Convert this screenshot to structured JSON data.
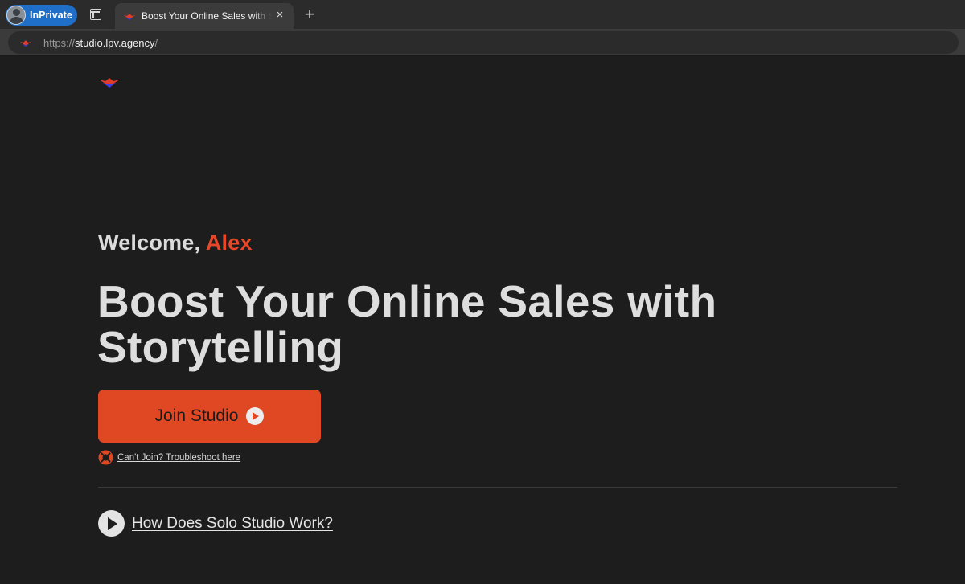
{
  "browser": {
    "inprivate_label": "InPrivate",
    "tab_title": "Boost Your Online Sales with Storytelling",
    "tab_close": "×",
    "new_tab": "+",
    "url_scheme": "https://",
    "url_host": "studio.lpv.agency",
    "url_path": "/"
  },
  "page": {
    "welcome_prefix": "Welcome,",
    "welcome_name": "Alex",
    "headline": "Boost Your Online Sales with Storytelling",
    "join_button_label": "Join Studio",
    "troubleshoot_link": "Can't Join? Troubleshoot here",
    "how_link": "How Does Solo Studio Work?"
  },
  "colors": {
    "accent": "#e04823",
    "name_accent": "#e8482a",
    "background": "#1e1d1e",
    "inprivate": "#1f6fc8"
  },
  "icons": {
    "logo": "brand-bird-logo",
    "join_button": "play-circle-icon",
    "troubleshoot": "lifebuoy-icon",
    "how": "play-circle-icon"
  }
}
